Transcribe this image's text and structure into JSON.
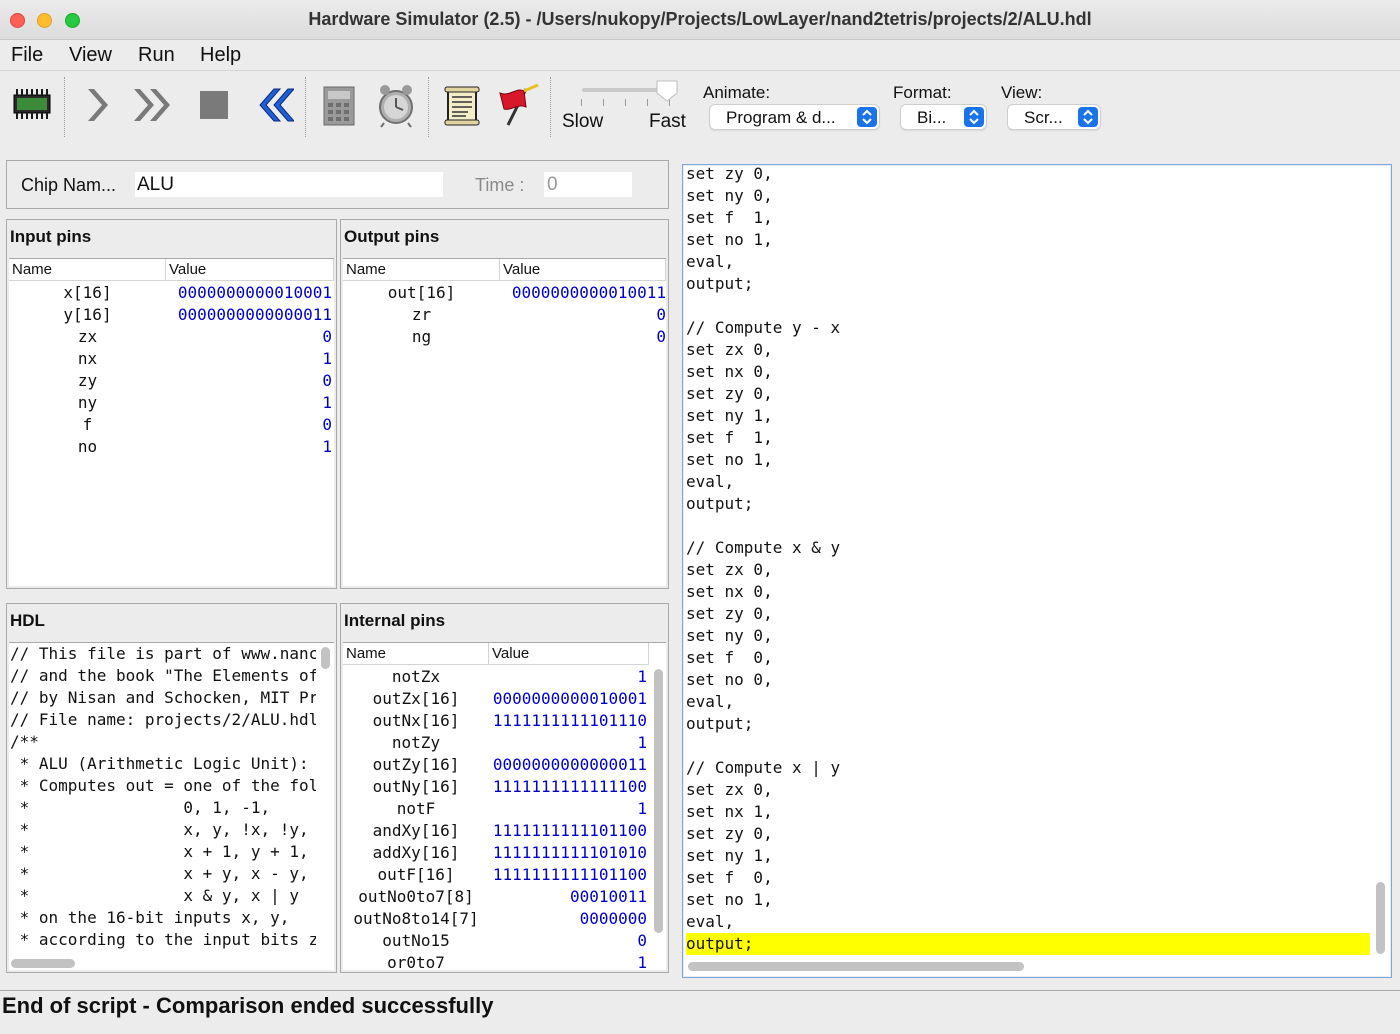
{
  "window": {
    "title": "Hardware Simulator (2.5) - /Users/nukopy/Projects/LowLayer/nand2tetris/projects/2/ALU.hdl"
  },
  "menu": {
    "items": [
      "File",
      "View",
      "Run",
      "Help"
    ]
  },
  "toolbar": {
    "icons": [
      "chip-load-icon",
      "single-step-icon",
      "run-icon",
      "stop-icon",
      "rewind-icon",
      "calculator-icon",
      "clock-icon",
      "script-icon",
      "breakpoint-flag-icon"
    ],
    "speed": {
      "slow_label": "Slow",
      "fast_label": "Fast",
      "level": 1.0
    },
    "animate": {
      "label": "Animate:",
      "value": "Program & d..."
    },
    "format": {
      "label": "Format:",
      "value": "Bi..."
    },
    "view": {
      "label": "View:",
      "value": "Scr..."
    }
  },
  "chip": {
    "label": "Chip Nam...",
    "value": "ALU",
    "time_label": "Time :",
    "time_value": "0"
  },
  "input_pins": {
    "title": "Input pins",
    "columns": [
      "Name",
      "Value"
    ],
    "rows": [
      {
        "name": "x[16]",
        "value": "0000000000010001"
      },
      {
        "name": "y[16]",
        "value": "0000000000000011"
      },
      {
        "name": "zx",
        "value": "0"
      },
      {
        "name": "nx",
        "value": "1"
      },
      {
        "name": "zy",
        "value": "0"
      },
      {
        "name": "ny",
        "value": "1"
      },
      {
        "name": "f",
        "value": "0"
      },
      {
        "name": "no",
        "value": "1"
      }
    ]
  },
  "output_pins": {
    "title": "Output pins",
    "columns": [
      "Name",
      "Value"
    ],
    "rows": [
      {
        "name": "out[16]",
        "value": "0000000000010011"
      },
      {
        "name": "zr",
        "value": "0"
      },
      {
        "name": "ng",
        "value": "0"
      }
    ]
  },
  "hdl": {
    "title": "HDL",
    "lines": [
      "// This file is part of www.nanc",
      "// and the book \"The Elements of",
      "// by Nisan and Schocken, MIT Pr",
      "// File name: projects/2/ALU.hdl",
      "/**",
      " * ALU (Arithmetic Logic Unit):",
      " * Computes out = one of the fol",
      " *                0, 1, -1,",
      " *                x, y, !x, !y,",
      " *                x + 1, y + 1,",
      " *                x + y, x - y,",
      " *                x & y, x | y",
      " * on the 16-bit inputs x, y,",
      " * according to the input bits z"
    ]
  },
  "internal_pins": {
    "title": "Internal pins",
    "columns": [
      "Name",
      "Value"
    ],
    "rows": [
      {
        "name": "notZx",
        "value": "1"
      },
      {
        "name": "outZx[16]",
        "value": "0000000000010001"
      },
      {
        "name": "outNx[16]",
        "value": "1111111111101110"
      },
      {
        "name": "notZy",
        "value": "1"
      },
      {
        "name": "outZy[16]",
        "value": "0000000000000011"
      },
      {
        "name": "outNy[16]",
        "value": "1111111111111100"
      },
      {
        "name": "notF",
        "value": "1"
      },
      {
        "name": "andXy[16]",
        "value": "1111111111101100"
      },
      {
        "name": "addXy[16]",
        "value": "1111111111101010"
      },
      {
        "name": "outF[16]",
        "value": "1111111111101100"
      },
      {
        "name": "outNo0to7[8]",
        "value": "00010011"
      },
      {
        "name": "outNo8to14[7]",
        "value": "0000000"
      },
      {
        "name": "outNo15",
        "value": "0"
      },
      {
        "name": "or0to7",
        "value": "1"
      }
    ]
  },
  "script": {
    "lines": [
      "set zy 0,",
      "set ny 0,",
      "set f  1,",
      "set no 1,",
      "eval,",
      "output;",
      "",
      "// Compute y - x",
      "set zx 0,",
      "set nx 0,",
      "set zy 0,",
      "set ny 1,",
      "set f  1,",
      "set no 1,",
      "eval,",
      "output;",
      "",
      "// Compute x & y",
      "set zx 0,",
      "set nx 0,",
      "set zy 0,",
      "set ny 0,",
      "set f  0,",
      "set no 0,",
      "eval,",
      "output;",
      "",
      "// Compute x | y",
      "set zx 0,",
      "set nx 1,",
      "set zy 0,",
      "set ny 1,",
      "set f  0,",
      "set no 1,",
      "eval,",
      "output;"
    ],
    "highlighted_line": 35
  },
  "status": {
    "message": "End of script - Comparison ended successfully"
  },
  "colors": {
    "value_blue": "#0000cc",
    "highlight": "#ffff00",
    "accent": "#1a73e8"
  }
}
